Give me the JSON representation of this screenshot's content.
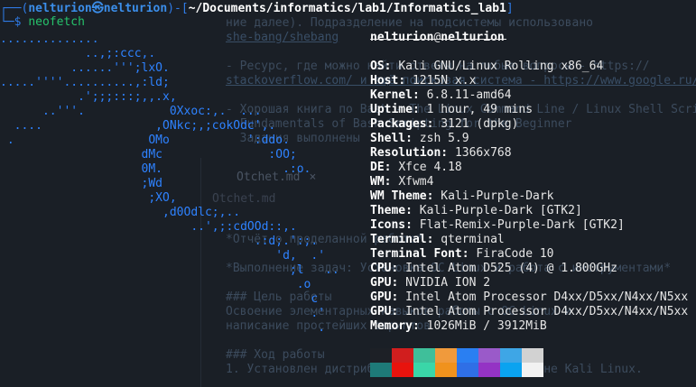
{
  "background": {
    "lines": [
      {
        "text": "ние далее). Подразделение на подсистемы использовано",
        "kind": "text"
      },
      {
        "text": "she-bang/shebang",
        "kind": "link"
      },
      {
        "text": "- Ресурс, где можно найти ответы на любые вопросы - https://",
        "kind": "text"
      },
      {
        "text": "stackoverflow.com/ и ещё поисковая система - https://www.google.ru/",
        "kind": "link"
      },
      {
        "text": "- Хорошая книга по Bash - The Linux Command Line / Linux Shell Scripting",
        "kind": "text"
      },
      {
        "text": "  Fundamentals of Bash Scripting for the Beginner",
        "kind": "text"
      },
      {
        "text": "  Задания выполнены",
        "kind": "text"
      },
      {
        "text": "*Отчёт о проделанной работе*",
        "kind": "text"
      },
      {
        "text": "*Выполнение задач: Установка ОС Linux и работа с инструментами*",
        "kind": "text"
      },
      {
        "text": "### Цель работы",
        "kind": "text"
      },
      {
        "text": "Освоение элементарных навыков работы с ОС Linux и",
        "kind": "text"
      },
      {
        "text": "написание простейших скриптов",
        "kind": "text"
      },
      {
        "text": "### Ход работы",
        "kind": "text"
      },
      {
        "text": "1. Установлен дистрибутив на виртуальной машине Kali Linux.",
        "kind": "text"
      }
    ],
    "tab_label": "Otchet.md",
    "tab_close": "×",
    "file_label": "Otchet.md"
  },
  "prompt": {
    "corner": "┌──(",
    "user": "nelturion㉿nelturion",
    "mid": ")-[",
    "path": "~/Documents/informatics/lab1/Informatics_lab1",
    "end": "]",
    "line2_prefix": "└─$ ",
    "command": "neofetch"
  },
  "logo": [
    "..............",
    "            ..,;:ccc,.",
    "          ......''';lxO.",
    ".....''''..........,:ld;",
    "           .';;;:::;,,.x,",
    "      ..'''.            0Xxoc:,.  ...",
    "  ....                ,ONkc;,;cokOdc',.",
    " .                   OMo           ':ddo.",
    "                    dMc               :OO;",
    "                    0M.                 .:o.",
    "                    ;Wd",
    "                     ;XO,",
    "                       ,d0Odlc;,..",
    "                           ..',;:cdOOd::,.",
    "                                    .:d;.':;.",
    "                                       'd,  .'",
    "                                         ;l   ..",
    "                                          .o",
    "                                            c",
    "                                            .'",
    "                                             ."
  ],
  "info": {
    "user": "nelturion",
    "at": "@",
    "host": "nelturion",
    "rows": [
      {
        "key": "OS",
        "value": "Kali GNU/Linux Rolling x86_64"
      },
      {
        "key": "Host",
        "value": "1215N x.x"
      },
      {
        "key": "Kernel",
        "value": "6.8.11-amd64"
      },
      {
        "key": "Uptime",
        "value": "1 hour, 49 mins"
      },
      {
        "key": "Packages",
        "value": "3121 (dpkg)"
      },
      {
        "key": "Shell",
        "value": "zsh 5.9"
      },
      {
        "key": "Resolution",
        "value": "1366x768"
      },
      {
        "key": "DE",
        "value": "Xfce 4.18"
      },
      {
        "key": "WM",
        "value": "Xfwm4"
      },
      {
        "key": "WM Theme",
        "value": "Kali-Purple-Dark"
      },
      {
        "key": "Theme",
        "value": "Kali-Purple-Dark [GTK2]"
      },
      {
        "key": "Icons",
        "value": "Flat-Remix-Purple-Dark [GTK2]"
      },
      {
        "key": "Terminal",
        "value": "qterminal"
      },
      {
        "key": "Terminal Font",
        "value": "FiraCode 10"
      },
      {
        "key": "CPU",
        "value": "Intel Atom D525 (4) @ 1.800GHz"
      },
      {
        "key": "GPU",
        "value": "NVIDIA ION 2"
      },
      {
        "key": "GPU",
        "value": "Intel Atom Processor D4xx/D5xx/N4xx/N5xx"
      },
      {
        "key": "GPU",
        "value": "Intel Atom Processor D4xx/D5xx/N4xx/N5xx"
      },
      {
        "key": "Memory",
        "value": "1026MiB / 3912MiB"
      }
    ]
  },
  "palette": {
    "row1": [
      "#1d2026",
      "#d11e1e",
      "#3fbf9a",
      "#f09a3c",
      "#2a7ff2",
      "#9a5ac9",
      "#3ea6e6",
      "#d2d2d2"
    ],
    "row2": [
      "#1e7a78",
      "#e8130d",
      "#3ad6a8",
      "#f0921d",
      "#2f6fe6",
      "#9433c4",
      "#0aa3f0",
      "#f2f2f2"
    ]
  }
}
